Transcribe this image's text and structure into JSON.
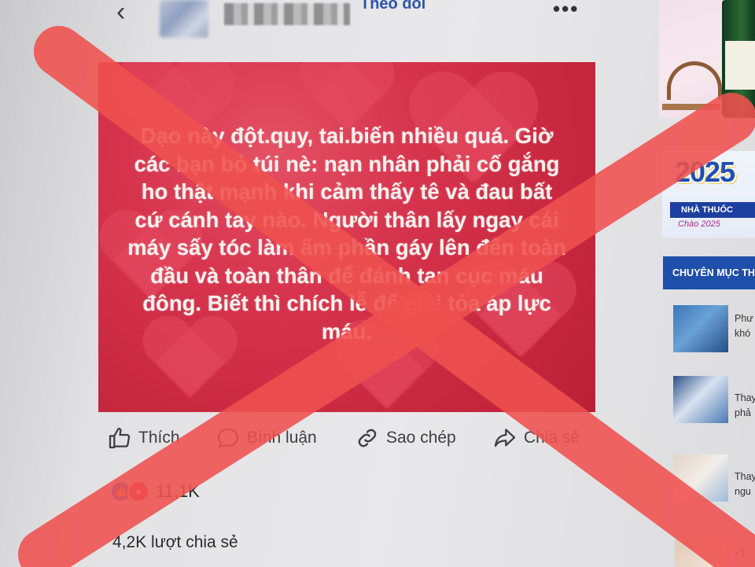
{
  "header": {
    "follow_label": "Theo dõi"
  },
  "post": {
    "text": "Dạo này đột.quy, tai.biến nhiều quá. Giờ các bạn bỏ túi nè: nạn nhân phải cố gắng ho thật mạnh khi cảm thấy tê và đau bất cứ cánh tay nào. Người thân lấy ngay cái máy sấy tóc làm ấm phần gáy lên đến toàn đầu và toàn thân để đánh tan cục máu đông. Biết thì chích lễ để giải tỏa áp lực máu."
  },
  "actions": {
    "like": "Thích",
    "comment": "Bình luận",
    "copy": "Sao chép",
    "share": "Chia sẻ"
  },
  "stats": {
    "reactions": "11,1K",
    "shares": "4,2K lượt chia sẻ"
  },
  "sidebar": {
    "ad_year": "2025",
    "ad_title": "NHÀ THUỐC",
    "ad_subtitle": "Chào 2025",
    "category_header": "CHUYÊN MỤC THỜI SỰ",
    "items": [
      {
        "snippet_1": "Phư",
        "snippet_2": "khó"
      },
      {
        "snippet_1": "Thay",
        "snippet_2": "phả"
      },
      {
        "snippet_1": "Thay",
        "snippet_2": "ngu"
      }
    ],
    "bottom_snippet": "• T"
  },
  "colors": {
    "post_background": "#d6344c",
    "overlay_x": "#f0514f",
    "accent_blue": "#1e4faa"
  }
}
